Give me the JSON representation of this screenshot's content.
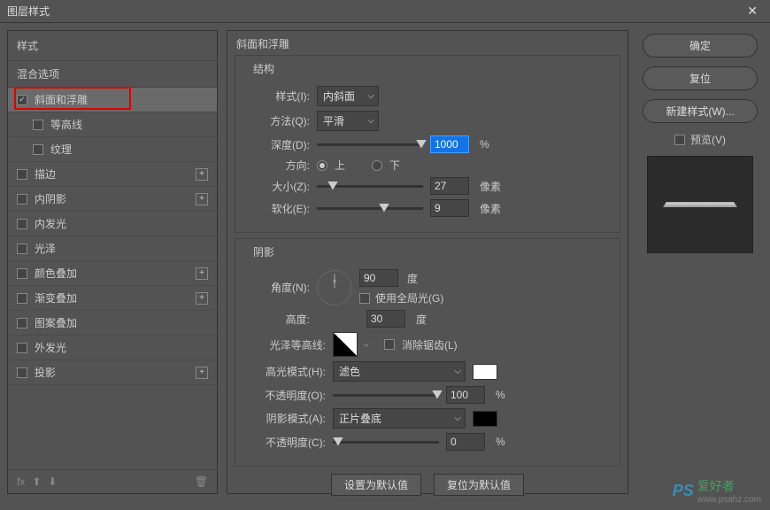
{
  "window": {
    "title": "图层样式",
    "close": "✕"
  },
  "panel": {
    "styles_header": "样式",
    "blend_header": "混合选项",
    "items": [
      {
        "label": "斜面和浮雕",
        "checked": true,
        "selected": true,
        "highlight": true
      },
      {
        "label": "等高线",
        "checked": false,
        "sub": true
      },
      {
        "label": "纹理",
        "checked": false,
        "sub": true
      },
      {
        "label": "描边",
        "checked": false,
        "plus": true
      },
      {
        "label": "内阴影",
        "checked": false,
        "plus": true
      },
      {
        "label": "内发光",
        "checked": false
      },
      {
        "label": "光泽",
        "checked": false
      },
      {
        "label": "颜色叠加",
        "checked": false,
        "plus": true
      },
      {
        "label": "渐变叠加",
        "checked": false,
        "plus": true
      },
      {
        "label": "图案叠加",
        "checked": false
      },
      {
        "label": "外发光",
        "checked": false
      },
      {
        "label": "投影",
        "checked": false,
        "plus": true
      }
    ],
    "footer_fx": "fx"
  },
  "settings": {
    "title": "斜面和浮雕",
    "structure": {
      "group_label": "结构",
      "style_label": "样式(I):",
      "style_value": "内斜面",
      "technique_label": "方法(Q):",
      "technique_value": "平滑",
      "depth_label": "深度(D):",
      "depth_value": "1000",
      "depth_unit": "%",
      "direction_label": "方向:",
      "up": "上",
      "down": "下",
      "size_label": "大小(Z):",
      "size_value": "27",
      "size_unit": "像素",
      "soften_label": "软化(E):",
      "soften_value": "9",
      "soften_unit": "像素"
    },
    "shading": {
      "group_label": "阴影",
      "angle_label": "角度(N):",
      "angle_value": "90",
      "angle_unit": "度",
      "global_light": "使用全局光(G)",
      "altitude_label": "高度:",
      "altitude_value": "30",
      "altitude_unit": "度",
      "gloss_contour_label": "光泽等高线:",
      "antialiased": "消除锯齿(L)",
      "highlight_mode_label": "高光模式(H):",
      "highlight_mode_value": "滤色",
      "highlight_opacity_label": "不透明度(O):",
      "highlight_opacity_value": "100",
      "opacity_unit": "%",
      "shadow_mode_label": "阴影模式(A):",
      "shadow_mode_value": "正片叠底",
      "shadow_opacity_label": "不透明度(C):",
      "shadow_opacity_value": "0"
    },
    "defaults": {
      "set": "设置为默认值",
      "reset": "复位为默认值"
    }
  },
  "actions": {
    "ok": "确定",
    "reset": "复位",
    "new_style": "新建样式(W)...",
    "preview": "预览(V)"
  },
  "watermark": {
    "ps": "PS",
    "text": "爱好者",
    "url": "www.psahz.com"
  }
}
